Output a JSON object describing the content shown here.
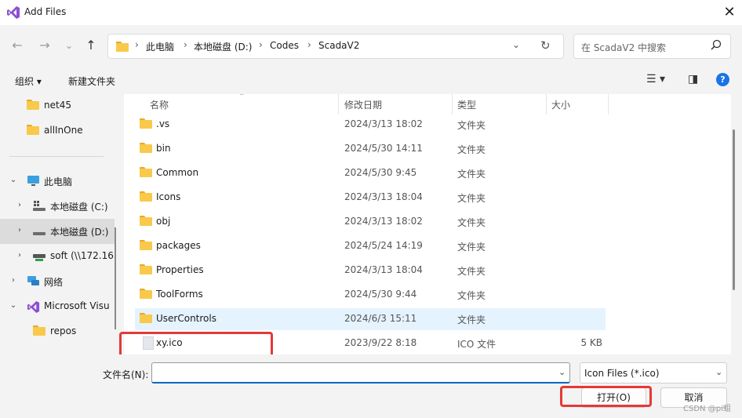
{
  "window": {
    "title": "Add Files",
    "close_glyph": "✕"
  },
  "nav": {
    "back": "←",
    "forward": "→",
    "recent": "⌄",
    "up": "↑"
  },
  "address": {
    "crumbs": [
      "此电脑",
      "本地磁盘 (D:)",
      "Codes",
      "ScadaV2"
    ],
    "separator": "›",
    "dropdown_glyph": "⌄",
    "refresh_glyph": "↻"
  },
  "search": {
    "placeholder": "在 ScadaV2 中搜索",
    "icon": "search-icon"
  },
  "toolbar": {
    "organize": "组织 ▾",
    "new_folder": "新建文件夹",
    "view_glyph": "☰ ▾",
    "pane_glyph": "◨",
    "help_glyph": "?"
  },
  "sidebar": {
    "items": [
      {
        "label": "net45",
        "icon": "folder-icon"
      },
      {
        "label": "allInOne",
        "icon": "folder-icon"
      },
      {
        "label": "此电脑",
        "icon": "computer-icon",
        "expanded": true
      },
      {
        "label": "本地磁盘 (C:)",
        "icon": "drive-icon"
      },
      {
        "label": "本地磁盘 (D:)",
        "icon": "drive-icon",
        "selected": true
      },
      {
        "label": "soft (\\\\172.16",
        "icon": "network-drive-icon"
      },
      {
        "label": "网络",
        "icon": "network-icon"
      },
      {
        "label": "Microsoft Visu",
        "icon": "visual-studio-icon",
        "expanded": true
      },
      {
        "label": "repos",
        "icon": "folder-icon"
      }
    ],
    "chev_right": "›",
    "chev_down": "⌄"
  },
  "columns": {
    "name": "名称",
    "date": "修改日期",
    "type": "类型",
    "size": "大小",
    "sort_glyph": "⌃"
  },
  "files": [
    {
      "name": ".vs",
      "date": "2024/3/13 18:02",
      "type": "文件夹",
      "size": ""
    },
    {
      "name": "bin",
      "date": "2024/5/30 14:11",
      "type": "文件夹",
      "size": ""
    },
    {
      "name": "Common",
      "date": "2024/5/30 9:45",
      "type": "文件夹",
      "size": ""
    },
    {
      "name": "Icons",
      "date": "2024/3/13 18:04",
      "type": "文件夹",
      "size": ""
    },
    {
      "name": "obj",
      "date": "2024/3/13 18:02",
      "type": "文件夹",
      "size": ""
    },
    {
      "name": "packages",
      "date": "2024/5/24 14:19",
      "type": "文件夹",
      "size": ""
    },
    {
      "name": "Properties",
      "date": "2024/3/13 18:04",
      "type": "文件夹",
      "size": ""
    },
    {
      "name": "ToolForms",
      "date": "2024/5/30 9:44",
      "type": "文件夹",
      "size": ""
    },
    {
      "name": "UserControls",
      "date": "2024/6/3 15:11",
      "type": "文件夹",
      "size": ""
    },
    {
      "name": "xy.ico",
      "date": "2023/9/22 8:18",
      "type": "ICO 文件",
      "size": "5 KB"
    }
  ],
  "footer": {
    "filename_label": "文件名(N):",
    "filename_value": "",
    "filter_label": "Icon Files (*.ico)",
    "dropdown_glyph": "⌄",
    "open_label": "打开(O)",
    "cancel_label": "取消",
    "watermark": "CSDN @pi蛆"
  },
  "colors": {
    "accent": "#0067c0",
    "highlight": "#e53935",
    "hover_row": "#e5f3ff",
    "folder": "#f8c94a"
  }
}
